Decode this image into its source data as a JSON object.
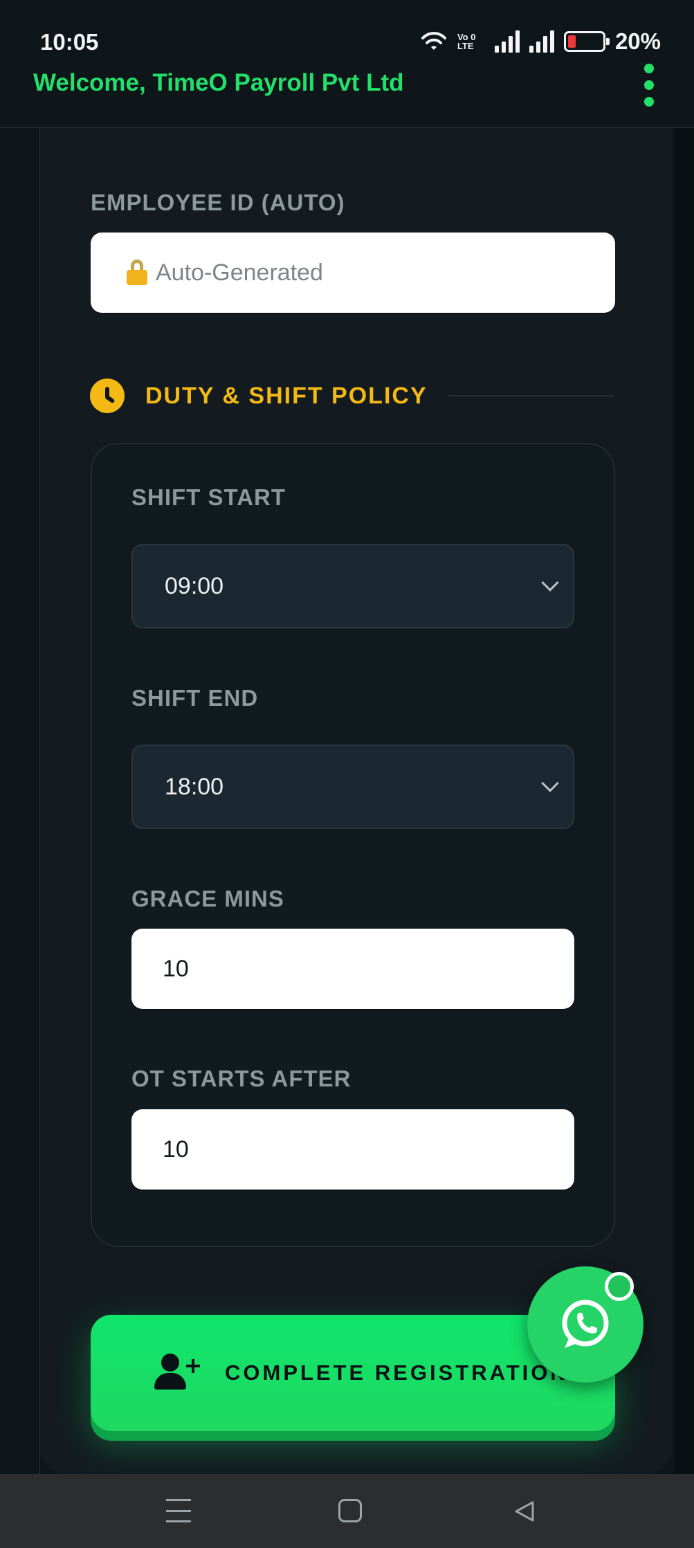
{
  "status_bar": {
    "time": "10:05",
    "volte_line1": "Vo 0",
    "volte_line2": "LTE",
    "battery_percent": "20%",
    "battery_level": 0.2,
    "icons": [
      "wifi-icon",
      "volte-icon",
      "signal-icon",
      "signal-icon",
      "battery-icon"
    ]
  },
  "header": {
    "welcome": "Welcome, TimeO Payroll Pvt Ltd",
    "menu_icon": "kebab-menu-icon"
  },
  "form": {
    "employee_id": {
      "label": "EMPLOYEE ID (AUTO)",
      "placeholder": "Auto-Generated",
      "icon": "lock-icon"
    },
    "section": {
      "title": "DUTY & SHIFT POLICY",
      "icon": "clock-icon"
    },
    "shift_start": {
      "label": "SHIFT START",
      "value": "09:00"
    },
    "shift_end": {
      "label": "SHIFT END",
      "value": "18:00"
    },
    "grace_mins": {
      "label": "GRACE MINS",
      "value": "10"
    },
    "ot_starts_after": {
      "label": "OT STARTS AFTER",
      "value": "10"
    },
    "submit_label": "COMPLETE REGISTRATION"
  },
  "colors": {
    "accent_green": "#22e06b",
    "section_yellow": "#f5b915",
    "whatsapp_green": "#25d366",
    "background": "#0f1619"
  },
  "navbar": {
    "icons": [
      "recent-apps-icon",
      "home-icon",
      "back-icon"
    ]
  }
}
